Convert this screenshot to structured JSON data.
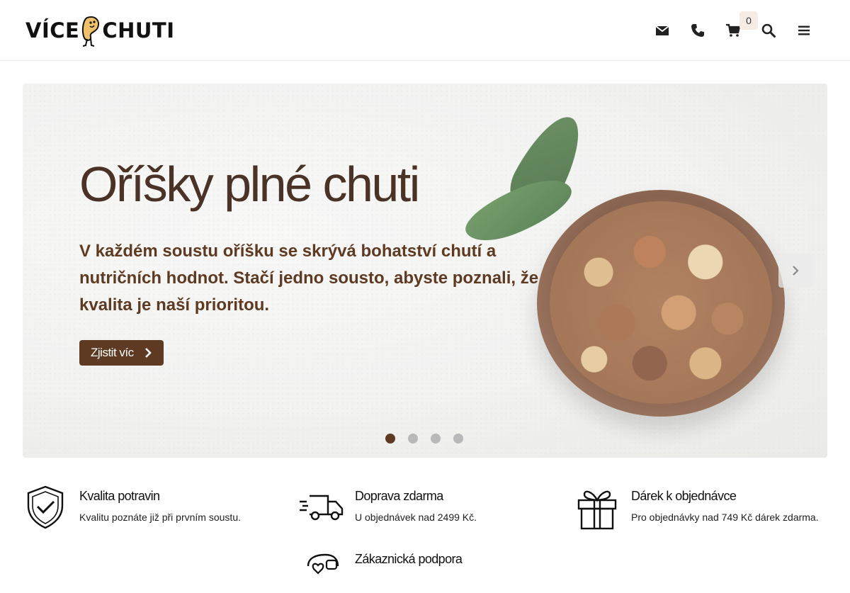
{
  "header": {
    "logo_text_left": "VÍCE",
    "logo_text_right": "CHUTI",
    "cart_count": "0",
    "icons": [
      "envelope-icon",
      "phone-icon",
      "cart-icon",
      "search-icon",
      "menu-icon"
    ]
  },
  "hero": {
    "title": "Oříšky plné chuti",
    "text": "V každém soustu oříšku se skrývá bohatství chutí a nutričních hodnot. Stačí jedno sousto, abyste poznali, že kvalita je naší prioritou.",
    "cta_label": "Zjistit víc",
    "slides_total": 4,
    "active_slide": 1
  },
  "features": [
    {
      "title": "Kvalita potravin",
      "desc": "Kvalitu poznáte již při prvním soustu.",
      "icon": "shield-check-icon"
    },
    {
      "title": "Doprava zdarma",
      "desc": "U objednávek nad 2499 Kč.",
      "icon": "delivery-truck-icon"
    },
    {
      "title": "Dárek k objednávce",
      "desc": "Pro objednávky nad 749 Kč dárek zdarma.",
      "icon": "gift-icon"
    },
    {
      "title": "Zákaznická podpora",
      "desc": "",
      "icon": "support-icon"
    }
  ],
  "colors": {
    "brand_brown": "#5e3a22",
    "title_brown": "#4a3326",
    "badge_bg": "#f6ece6"
  }
}
